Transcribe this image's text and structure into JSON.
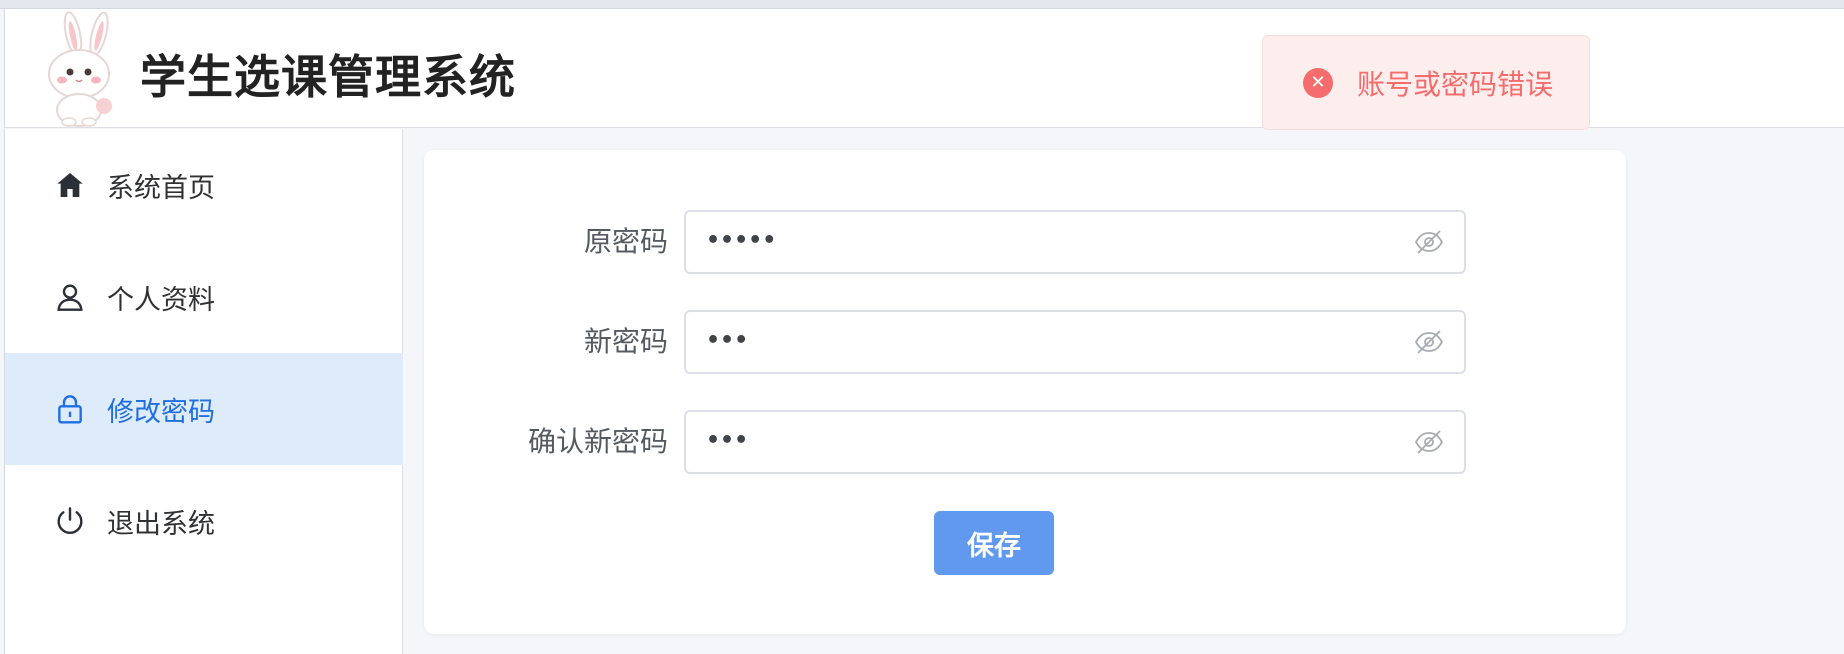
{
  "header": {
    "title": "学生选课管理系统",
    "logo_icon": "bunny-mascot-logo"
  },
  "sidebar": {
    "items": [
      {
        "label": "系统首页",
        "icon": "home-icon",
        "active": false
      },
      {
        "label": "个人资料",
        "icon": "user-icon",
        "active": false
      },
      {
        "label": "修改密码",
        "icon": "lock-icon",
        "active": true
      },
      {
        "label": "退出系统",
        "icon": "power-icon",
        "active": false
      }
    ]
  },
  "form": {
    "old_password": {
      "label": "原密码",
      "value": "•••••"
    },
    "new_password": {
      "label": "新密码",
      "value": "•••"
    },
    "confirm_password": {
      "label": "确认新密码",
      "value": "•••"
    },
    "save_label": "保存"
  },
  "toast": {
    "message": "账号或密码错误",
    "icon": "error-circle-icon",
    "type": "error"
  },
  "colors": {
    "accent": "#1f6fe0",
    "active_bg": "#deebfb",
    "button": "#6199ee",
    "error": "#f56c6c",
    "error_bg": "#fdeeee"
  }
}
